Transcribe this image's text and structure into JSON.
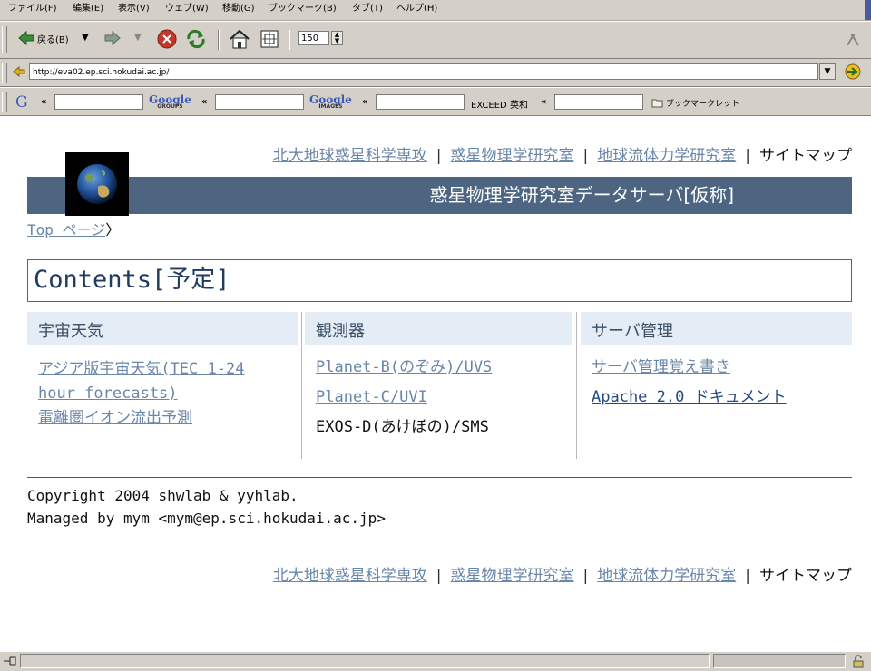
{
  "menu": [
    "ファイル(F)",
    "編集(E)",
    "表示(V)",
    "ウェブ(W)",
    "移動(G)",
    "ブックマーク(B)",
    "タブ(T)",
    "ヘルプ(H)"
  ],
  "nav": {
    "back_label": "戻る(B)",
    "zoom_value": "150"
  },
  "url": "http://eva02.ep.sci.hokudai.ac.jp/",
  "searchbar": {
    "google_web": "Google",
    "google_groups": "Google",
    "groups_sub": "GROUPS",
    "google_images": "Google",
    "images_sub": "IMAGES",
    "exceed_label": "EXCEED 英和",
    "bookmarklet_label": "ブックマークレット",
    "chevron": "«"
  },
  "topnav": {
    "links": [
      "北大地球惑星科学専攻",
      "惑星物理学研究室",
      "地球流体力学研究室"
    ],
    "current": "サイトマップ",
    "separator": "|"
  },
  "banner_title": "惑星物理学研究室データサーバ[仮称]",
  "breadcrumb": {
    "link": "Top ページ",
    "arrow": "〉"
  },
  "contents_title": "Contents[予定]",
  "columns": [
    {
      "header": "宇宙天気",
      "links": [
        "アジア版宇宙天気(TEC 1-24 hour forecasts)",
        "電離圏イオン流出予測"
      ]
    },
    {
      "header": "観測器",
      "links": [
        "Planet-B(のぞみ)/UVS",
        "Planet-C/UVI"
      ],
      "plain": "EXOS-D(あけぼの)/SMS"
    },
    {
      "header": "サーバ管理",
      "links": [
        "サーバ管理覚え書き",
        "Apache 2.0 ドキュメント"
      ]
    }
  ],
  "footer": {
    "copyright": "Copyright 2004 shwlab & yyhlab.",
    "managed": "Managed by mym <mym@ep.sci.hokudai.ac.jp>"
  },
  "colors": {
    "banner": "#4d6580",
    "link": "#6a86a8",
    "column_header_bg": "#e4ecf6"
  }
}
